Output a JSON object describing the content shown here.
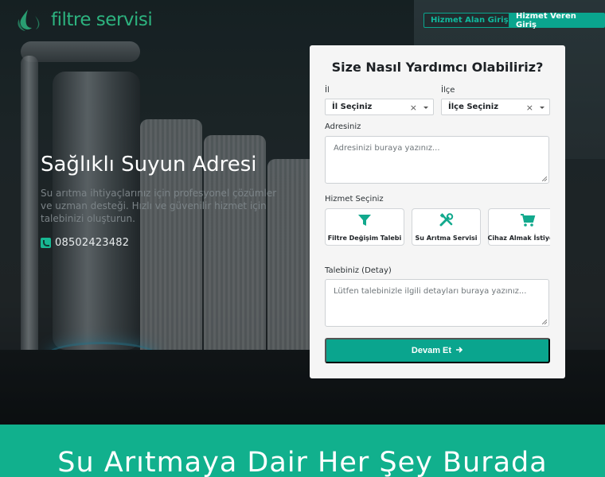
{
  "brand": {
    "name": "filtre servisi"
  },
  "header": {
    "login_customer": "Hizmet Alan Giriş",
    "login_provider": "Hizmet Veren Giriş"
  },
  "hero": {
    "title": "Sağlıklı Suyun Adresi",
    "description": "Su arıtma ihtiyaçlarınız için profesyonel çözümler ve uzman desteği. Hızlı ve güvenilir hizmet için talebinizi oluşturun.",
    "phone": "08502423482"
  },
  "form": {
    "title": "Size Nasıl Yardımcı Olabiliriz?",
    "city_label": "İl",
    "city_value": "İl Seçiniz",
    "district_label": "İlçe",
    "district_value": "İlçe Seçiniz",
    "address_label": "Adresiniz",
    "address_placeholder": "Adresinizi buraya yazınız...",
    "service_label": "Hizmet Seçiniz",
    "services": [
      {
        "label": "Filtre Değişim Talebi",
        "icon": "filter-icon"
      },
      {
        "label": "Su Arıtma Servisi",
        "icon": "tools-icon"
      },
      {
        "label": "Cihaz Almak İstiyorum",
        "icon": "cart-icon"
      }
    ],
    "detail_label": "Talebiniz (Detay)",
    "detail_placeholder": "Lütfen talebinizle ilgili detayları buraya yazınız...",
    "submit_label": "Devam Et"
  },
  "banner": {
    "title": "Su Arıtmaya Dair Her Şey Burada"
  },
  "colors": {
    "accent": "#0aa58e",
    "banner": "#11b08d",
    "logo": "#2db37f"
  }
}
